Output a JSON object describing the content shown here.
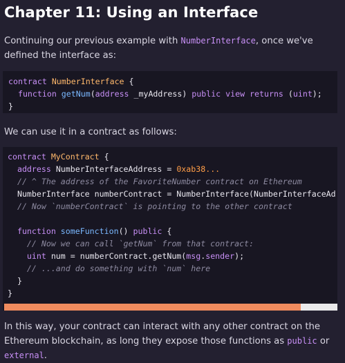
{
  "title": "Chapter 11: Using an Interface",
  "intro": {
    "before": "Continuing our previous example with ",
    "code": "NumberInterface",
    "after": ", once we've defined the interface as:"
  },
  "code1": [
    [
      [
        "kw",
        "contract "
      ],
      [
        "ty",
        "NumberInterface"
      ],
      [
        "",
        " {"
      ]
    ],
    [
      [
        "",
        "  "
      ],
      [
        "kw",
        "function "
      ],
      [
        "fn",
        "getNum"
      ],
      [
        "",
        "("
      ],
      [
        "kw",
        "address "
      ],
      [
        "",
        "_myAddress) "
      ],
      [
        "kw",
        "public view returns "
      ],
      [
        "",
        "("
      ],
      [
        "kw",
        "uint"
      ],
      [
        "",
        ");"
      ]
    ],
    [
      [
        "",
        "}"
      ]
    ]
  ],
  "usage_text": "We can use it in a contract as follows:",
  "code2": [
    [
      [
        "kw",
        "contract "
      ],
      [
        "ty",
        "MyContract"
      ],
      [
        "",
        " {"
      ]
    ],
    [
      [
        "",
        "  "
      ],
      [
        "kw",
        "address "
      ],
      [
        "",
        "NumberInterfaceAddress = "
      ],
      [
        "num",
        "0xab38..."
      ]
    ],
    [
      [
        "",
        "  "
      ],
      [
        "cm",
        "// ^ The address of the FavoriteNumber contract on Ethereum"
      ]
    ],
    [
      [
        "",
        "  NumberInterface numberContract = NumberInterface(NumberInterfaceAd"
      ]
    ],
    [
      [
        "",
        "  "
      ],
      [
        "cm",
        "// Now `numberContract` is pointing to the other contract"
      ]
    ],
    [
      [
        "",
        ""
      ]
    ],
    [
      [
        "",
        "  "
      ],
      [
        "kw",
        "function "
      ],
      [
        "fn",
        "someFunction"
      ],
      [
        "",
        "() "
      ],
      [
        "kw",
        "public"
      ],
      [
        "",
        " {"
      ]
    ],
    [
      [
        "",
        "    "
      ],
      [
        "cm",
        "// Now we can call `getNum` from that contract:"
      ]
    ],
    [
      [
        "",
        "    "
      ],
      [
        "kw",
        "uint "
      ],
      [
        "",
        "num = numberContract.getNum("
      ],
      [
        "kw",
        "msg"
      ],
      [
        "",
        "."
      ],
      [
        "kw",
        "sender"
      ],
      [
        "",
        ");"
      ]
    ],
    [
      [
        "",
        "    "
      ],
      [
        "cm",
        "// ...and do something with `num` here"
      ]
    ],
    [
      [
        "",
        "  }"
      ]
    ],
    [
      [
        "",
        "}"
      ]
    ]
  ],
  "scrollbar": {
    "position_fraction": 0.0,
    "visible_fraction": 0.89
  },
  "outro": {
    "before": "In this way, your contract can interact with any other contract on the Ethereum blockchain, as long they expose those functions as ",
    "code1": "public",
    "middle": " or ",
    "code2": "external",
    "after": "."
  },
  "colors": {
    "background": "#232030",
    "code_background": "#181622",
    "keyword": "#c78ff5",
    "function": "#7ab8ff",
    "type": "#ffb86b",
    "number": "#ff9d47",
    "comment": "#8d8aa0",
    "scroll_thumb": "#f08b5e"
  }
}
